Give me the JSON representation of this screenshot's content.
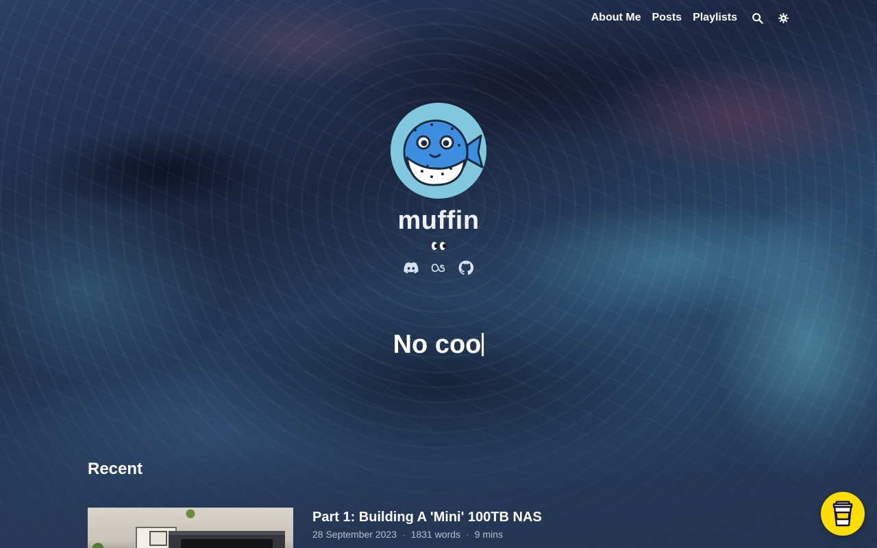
{
  "nav": {
    "items": [
      {
        "label": "About Me"
      },
      {
        "label": "Posts"
      },
      {
        "label": "Playlists"
      }
    ],
    "search_icon": "search-icon",
    "theme_icon": "settings-icon"
  },
  "profile": {
    "name": "muffin",
    "emoji": "eyes",
    "socials": [
      "discord-icon",
      "lastfm-icon",
      "github-icon"
    ],
    "typed_text": "No coo"
  },
  "recent": {
    "heading": "Recent",
    "posts": [
      {
        "title": "Part 1: Building A 'Mini' 100TB NAS",
        "date": "28 September 2023",
        "words": "1831 words",
        "read_time": "9 mins"
      }
    ]
  },
  "colors": {
    "coffee_button": "#ffdd00",
    "avatar_bg": "#7fc8de"
  }
}
